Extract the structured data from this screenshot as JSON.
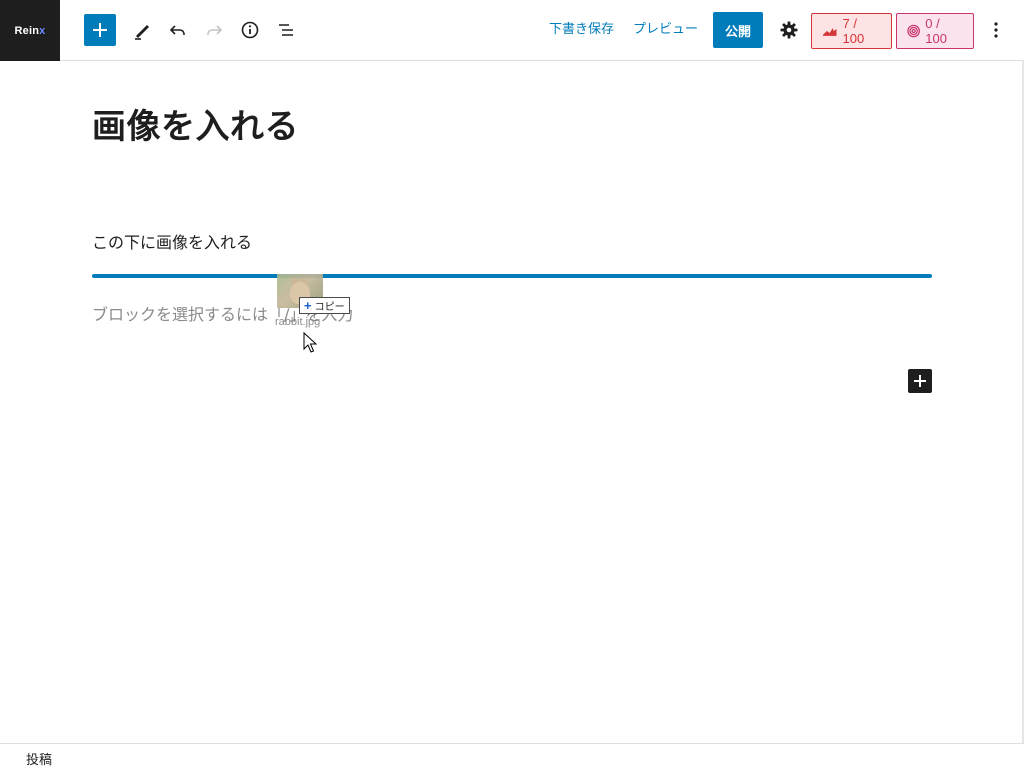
{
  "logo": {
    "text_main": "Rein",
    "text_accent": "x"
  },
  "toolbar": {
    "save_draft_label": "下書き保存",
    "preview_label": "プレビュー",
    "publish_label": "公開",
    "seo_score": "7 / 100",
    "readability_score": "0 / 100"
  },
  "editor": {
    "post_title": "画像を入れる",
    "paragraph": "この下に画像を入れる",
    "placeholder": "ブロックを選択するには「/」を入力"
  },
  "drag": {
    "filename": "rabbit.jpg",
    "copy_label": "コピー"
  },
  "footer": {
    "breadcrumb": "投稿"
  },
  "colors": {
    "accent": "#007cba",
    "seo": "#d63638",
    "readability": "#c9356e",
    "dark": "#1e1e1e"
  }
}
